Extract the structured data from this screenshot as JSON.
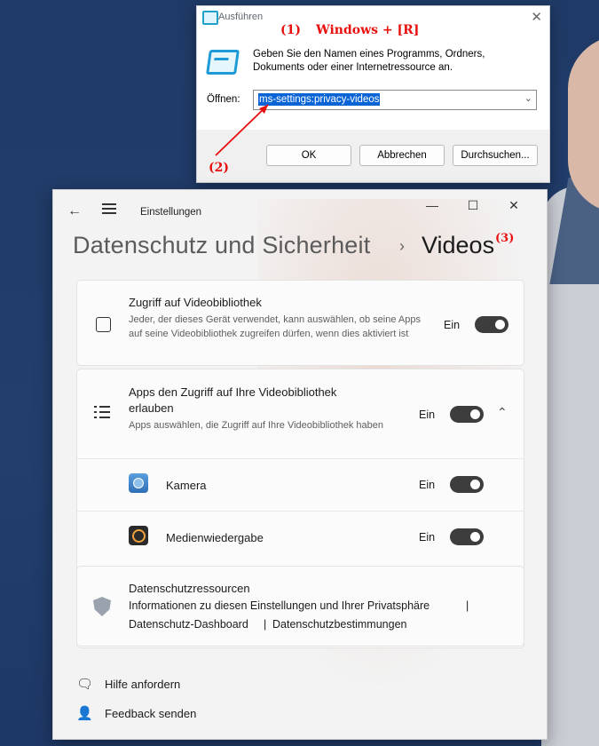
{
  "run_dialog": {
    "title": "Ausführen",
    "close_glyph": "✕",
    "description": "Geben Sie den Namen eines Programms, Ordners, Dokuments oder einer Internetressource an.",
    "open_label": "Öffnen:",
    "command_value": "ms-settings:privacy-videos",
    "buttons": {
      "ok": "OK",
      "cancel": "Abbrechen",
      "browse": "Durchsuchen..."
    }
  },
  "annotations": {
    "step1_number": "(1)",
    "step1_text": "Windows + [R]",
    "step2": "(2)",
    "step3": "(3)",
    "color": "#e8100f"
  },
  "settings": {
    "window_title": "Einstellungen",
    "breadcrumb_parent": "Datenschutz und Sicherheit",
    "breadcrumb_separator": "›",
    "breadcrumb_current": "Videos",
    "video_library": {
      "title": "Zugriff auf Videobibliothek",
      "description": "Jeder, der dieses Gerät verwendet, kann auswählen, ob seine Apps auf seine Videobibliothek zugreifen dürfen, wenn dies aktiviert ist",
      "state": "Ein"
    },
    "app_access": {
      "title": "Apps den Zugriff auf Ihre Videobibliothek erlauben",
      "description": "Apps auswählen, die Zugriff auf Ihre Videobibliothek haben",
      "state": "Ein",
      "apps": [
        {
          "name": "Kamera",
          "state": "Ein"
        },
        {
          "name": "Medienwiedergabe",
          "state": "Ein"
        }
      ]
    },
    "privacy_resources": {
      "title": "Datenschutzressourcen",
      "link1": "Informationen zu diesen Einstellungen und Ihrer Privatsphäre",
      "link2": "Datenschutz-Dashboard",
      "link3": "Datenschutzbestimmungen",
      "separator": "|"
    },
    "help": "Hilfe anfordern",
    "feedback": "Feedback senden"
  }
}
